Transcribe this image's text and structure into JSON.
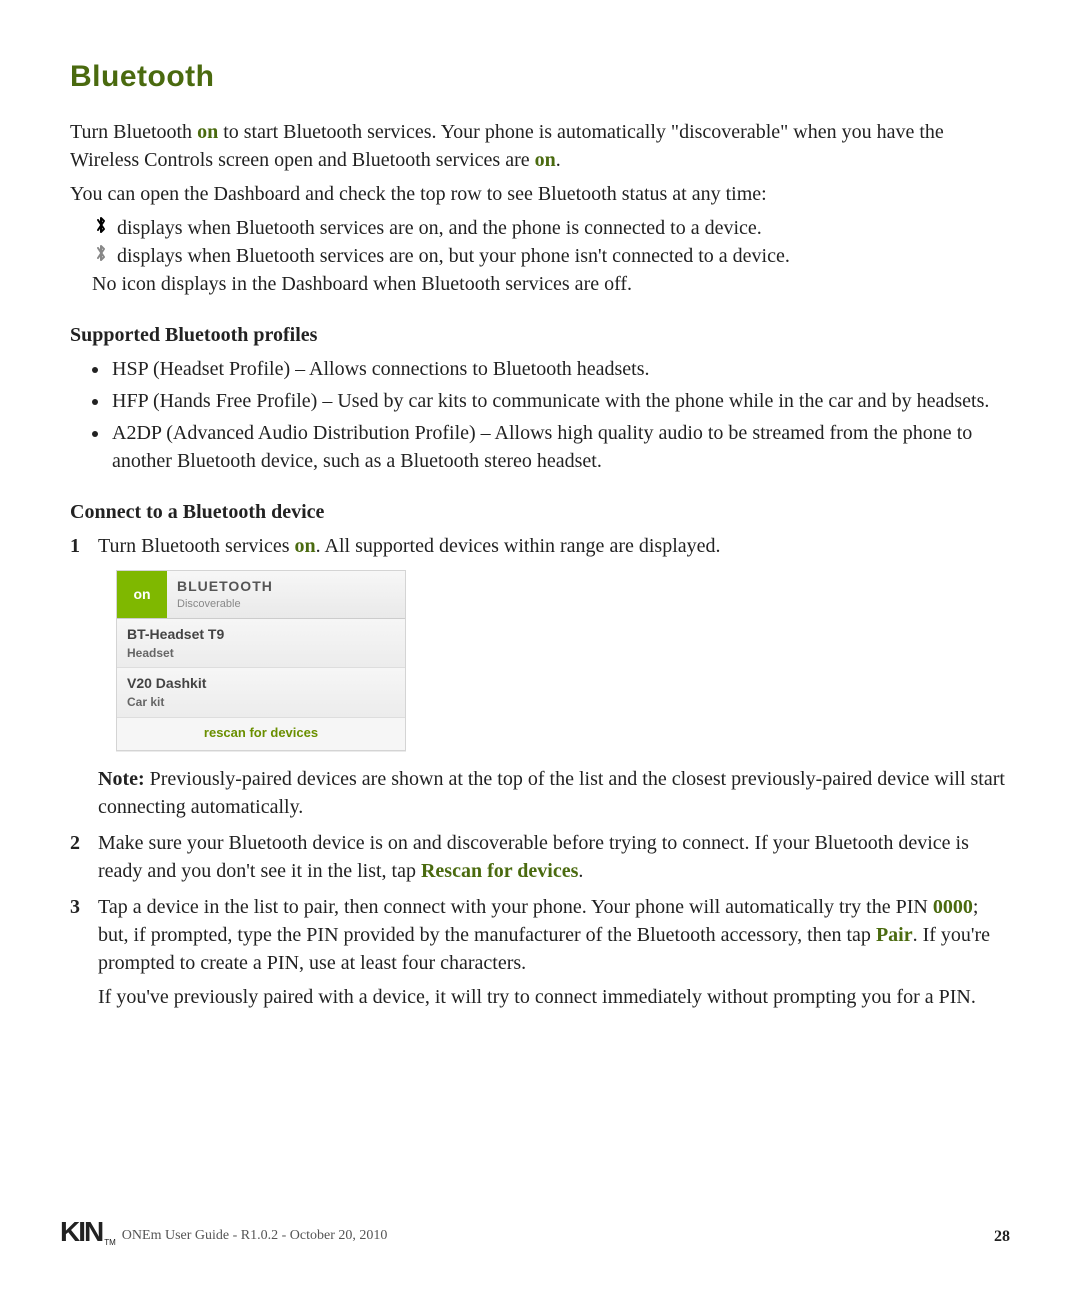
{
  "header": {
    "title": "Bluetooth"
  },
  "intro": {
    "p1a": "Turn Bluetooth ",
    "p1_on": "on",
    "p1b": " to start Bluetooth services. Your phone is automatically \"discoverable\" when you have the Wireless Controls screen open and Bluetooth services are ",
    "p1_on2": "on",
    "p1c": ".",
    "p2": "You can open the Dashboard and check the top row to see Bluetooth status at any time:"
  },
  "status": {
    "icon_connected": "࿂",
    "line_connected": " displays when Bluetooth services are on, and the phone is connected to a device.",
    "icon_unconnected": "࿂",
    "line_unconnected": " displays when Bluetooth services are on, but your phone isn't connected to a device.",
    "line_off": "No icon displays in the Dashboard when Bluetooth services are off."
  },
  "profiles": {
    "heading": "Supported Bluetooth profiles",
    "items": [
      "HSP (Headset Profile) – Allows connections to Bluetooth headsets.",
      "HFP (Hands Free Profile) – Used by car kits to communicate with the phone while in the car and by headsets.",
      "A2DP (Advanced Audio Distribution Profile) – Allows high quality audio to be streamed from the phone to another Bluetooth device, such as a Bluetooth stereo headset."
    ]
  },
  "connect": {
    "heading": "Connect to a Bluetooth device",
    "step1a": "Turn Bluetooth services ",
    "step1_on": "on",
    "step1b": ". All supported devices within range are displayed.",
    "note_lead": "Note:",
    "note_body": " Previously-paired devices are shown at the top of the list and the closest previously-paired device will start connecting automatically.",
    "step2a": "Make sure your Bluetooth device is on and discoverable before trying to connect. If your Bluetooth device is ready and you don't see it in the list, tap ",
    "step2_rescan": "Rescan for devices",
    "step2b": ".",
    "step3a": "Tap a device in the list to pair, then connect with your phone. Your phone will automatically try the PIN ",
    "step3_pin": "0000",
    "step3b": "; but, if prompted, type the PIN provided by the manufacturer of the Bluetooth accessory, then tap ",
    "step3_pair": "Pair",
    "step3c": ". If you're prompted to create a PIN, use at least four characters.",
    "step3_sub": "If you've previously paired with a device, it will try to connect immediately without prompting you for a PIN."
  },
  "devbox": {
    "on_label": "on",
    "title": "BLUETOOTH",
    "subtitle": "Discoverable",
    "devices": [
      {
        "name": "BT-Headset T9",
        "type": "Headset"
      },
      {
        "name": "V20 Dashkit",
        "type": "Car kit"
      }
    ],
    "rescan_label": "rescan for devices"
  },
  "footer": {
    "logo_text": "KIN",
    "tm": "TM",
    "doc_info": "ONEm User Guide - R1.0.2 - October 20, 2010",
    "page_number": "28"
  }
}
